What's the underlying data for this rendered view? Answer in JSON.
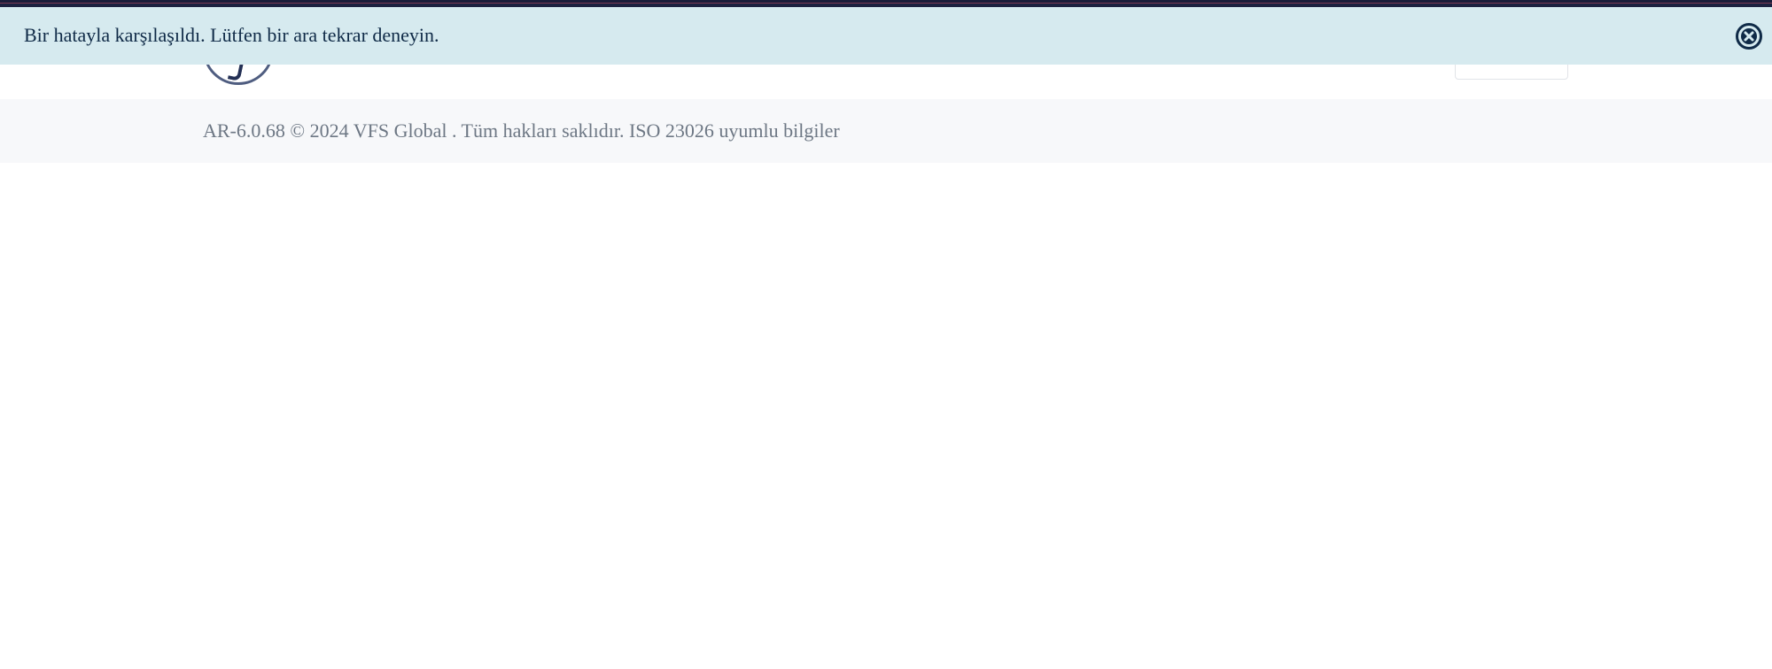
{
  "alert": {
    "message": "Bir hatayla karşılaşıldı. Lütfen bir ara tekrar deneyin.",
    "close_icon": "close-circle-icon"
  },
  "header": {
    "logo_icon": "vfs-logo-icon"
  },
  "footer": {
    "text": "AR-6.0.68 © 2024 VFS Global . Tüm hakları saklıdır. ISO 23026 uyumlu bilgiler"
  },
  "colors": {
    "alert_bg": "#d6eaef",
    "alert_text": "#0f2a47",
    "footer_bg": "#f7f8fa",
    "footer_text": "#6d7784",
    "top_stripe": "#1a1d3a"
  }
}
